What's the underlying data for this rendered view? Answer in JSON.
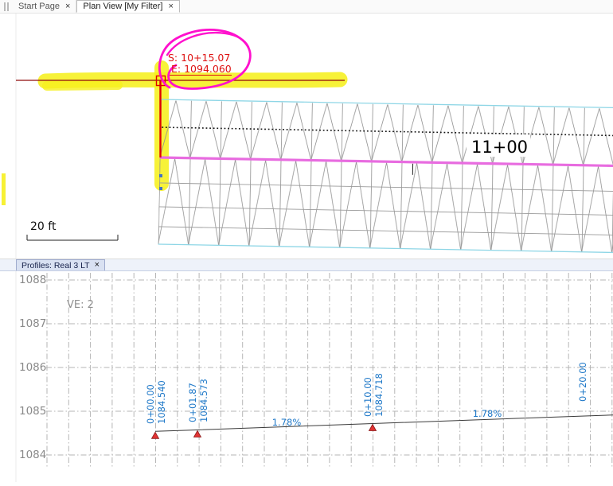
{
  "window": {
    "tabs": [
      {
        "label": "Start Page",
        "close": "×"
      },
      {
        "label": "Plan View [My Filter]",
        "close": "×"
      }
    ]
  },
  "plan": {
    "annotation": {
      "line1": "S: 10+15.07",
      "line2": "E: 1094.060"
    },
    "station_label": "11+00",
    "scale_label": "20 ft"
  },
  "profile_tab": {
    "label": "Profiles: Real 3 LT",
    "close": "×"
  },
  "profile": {
    "ve_label": "VE: 2",
    "elevations": [
      "1088",
      "1087",
      "1086",
      "1085",
      "1084"
    ],
    "points": [
      {
        "station": "0+00.00",
        "elevation": "1084.540"
      },
      {
        "station": "0+01.87",
        "elevation": "1084.573"
      },
      {
        "station": "0+10.00",
        "elevation": "1084.718"
      },
      {
        "station": "0+20.00",
        "elevation": ""
      }
    ],
    "grades": [
      "1.78%",
      "1.78%"
    ]
  },
  "colors": {
    "highlight_yellow": "#f6f01e",
    "dark_red": "#8f0a0a",
    "red": "#e00000",
    "sketch_magenta": "#ff10cd",
    "corridor_magenta": "#e86ce0",
    "cyan": "#8ed6e6",
    "label_blue": "#1e78c8",
    "grid_gray": "#b5b5b5"
  }
}
